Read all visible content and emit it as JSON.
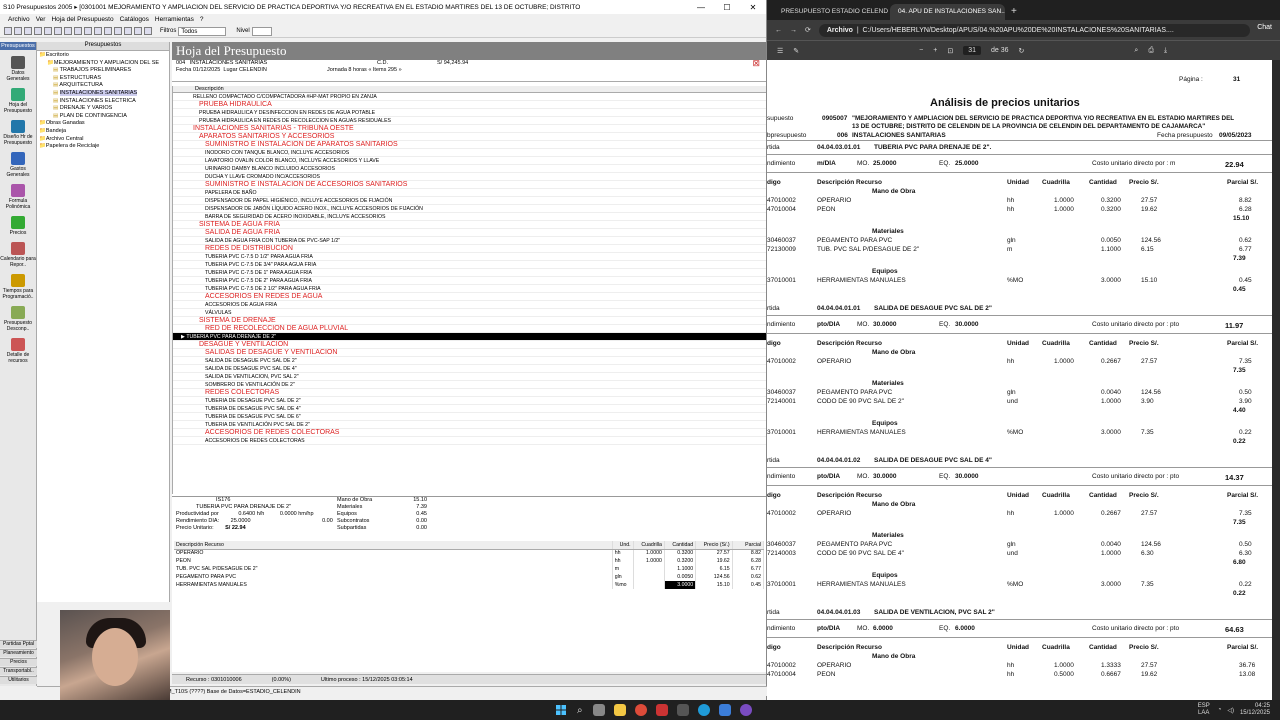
{
  "s10": {
    "title": "S10 Presupuestos 2005 ▸ [0301001 MEJORAMIENTO Y AMPLIACION DEL SERVICIO DE PRACTICA DEPORTIVA Y/O RECREATIVA EN EL ESTADIO MARTIRES DEL 13 DE OCTUBRE; DISTRITO",
    "menu": [
      "Archivo",
      "Ver",
      "Hoja del Presupuesto",
      "Catálogos",
      "Herramientas",
      "?"
    ],
    "filtros_label": "Filtros",
    "filtros_value": "Todos",
    "nivel_label": "Nivel",
    "nivel_value": "",
    "nav_header": "Presupuestos",
    "nav": [
      "Datos Generales",
      "Hoja del Presupuesto",
      "Diseño Hr de Presupuesto",
      "Gastos Generales",
      "Formula Polinómica",
      "Precios",
      "Calendario para Repor..",
      "Tiempos para Programació..",
      "Presupuesto Desconp..",
      "Detalle de recursos"
    ],
    "nav_bottom": [
      "Partidas Pptal",
      "Planeamiento",
      "Precios",
      "Transportabl..",
      "Utilitarios"
    ],
    "tree_header": "Presupuestos",
    "tree": [
      "Escritorio",
      "MEJORAMIENTO Y AMPLIACION DEL SE",
      "TRABAJOS PRELIMINARES",
      "ESTRUCTURAS",
      "ARQUITECTURA",
      "INSTALACIONES SANITARIAS",
      "INSTALACIONES ELECTRICA",
      "DRENAJE Y VARIOS",
      "PLAN DE CONTINGENCIA",
      "Obras Ganadas",
      "Bandeja",
      "Archivo Central",
      "Papelera de Reciclaje"
    ],
    "hoja_title": "Hoja del Presupuesto",
    "info": {
      "code": "004",
      "name": "INSTALACIONES SANITARIAS",
      "cd_label": "C.D.",
      "cd_value": "S/ 94,245.94",
      "fecha_label": "Fecha",
      "fecha": "01/12/2025",
      "lugar_label": "Lugar",
      "lugar": "CELENDIN",
      "jornada_label": "Jornada",
      "jornada": "8",
      "horas": "horas",
      "items": "« Items 295 »"
    },
    "col_descripcion": "Descripción",
    "rows": [
      {
        "t": 0,
        "i": 0,
        "text": "RELLENO COMPACTADO C/COMPACTADORA #HP-MAT PROPIO EN ZANJA"
      },
      {
        "t": 1,
        "i": 1,
        "text": "PRUEBA HIDRAULICA"
      },
      {
        "t": 0,
        "i": 1,
        "text": "PRUEBA HIDRAULICA Y DESINFECCION EN REDES DE AGUA POTABLE"
      },
      {
        "t": 0,
        "i": 1,
        "text": "PRUEBA HIDRAULICA EN REDES DE RECOLECCION EN AGUAS RESIDUALES"
      },
      {
        "t": 1,
        "i": 0,
        "text": "INSTALACIONES SANITARIAS - TRIBUNA OESTE"
      },
      {
        "t": 1,
        "i": 1,
        "text": "APARATOS SANITARIOS Y ACCESORIOS"
      },
      {
        "t": 1,
        "i": 2,
        "text": "SUMINISTRO E INSTALACION DE APARATOS SANITARIOS"
      },
      {
        "t": 0,
        "i": 2,
        "text": "INODORO CON TANQUE BLANCO, INCLUYE ACCESORIOS"
      },
      {
        "t": 0,
        "i": 2,
        "text": "LAVATORIO OVALIN COLOR BLANCO, INCLUYE ACCESORIOS Y LLAVE"
      },
      {
        "t": 0,
        "i": 2,
        "text": "URINARIO DAMBY BLANCO INCLUIDO ACCESORIOS"
      },
      {
        "t": 0,
        "i": 2,
        "text": "DUCHA Y LLAVE CROMADO INC/ACCESORIOS"
      },
      {
        "t": 1,
        "i": 2,
        "text": "SUMINISTRO E INSTALACION DE ACCESORIOS SANITARIOS"
      },
      {
        "t": 0,
        "i": 2,
        "text": "PAPELERA DE BAÑO"
      },
      {
        "t": 0,
        "i": 2,
        "text": "DISPENSADOR DE PAPEL HIGIÉNICO, INCLUYE ACCESORIOS DE FIJACIÓN"
      },
      {
        "t": 0,
        "i": 2,
        "text": "DISPENSADOR DE JABÓN LÍQUIDO ACERO INOX., INCLUYE ACCESORIOS DE FIJACIÓN"
      },
      {
        "t": 0,
        "i": 2,
        "text": "BARRA DE SEGURIDAD DE ACERO INOXIDABLE, INCLUYE ACCESORIOS"
      },
      {
        "t": 1,
        "i": 1,
        "text": "SISTEMA DE AGUA FRIA"
      },
      {
        "t": 1,
        "i": 2,
        "text": "SALIDA DE AGUA FRIA"
      },
      {
        "t": 0,
        "i": 2,
        "text": "SALIDA DE AGUA FRIA CON TUBERIA DE PVC-SAP 1/2\""
      },
      {
        "t": 1,
        "i": 2,
        "text": "REDES DE DISTRIBUCION"
      },
      {
        "t": 0,
        "i": 2,
        "text": "TUBERIA PVC C-7.5 D 1/2\" PARA AGUA FRIA"
      },
      {
        "t": 0,
        "i": 2,
        "text": "TUBERIA PVC C-7.5 DE 3/4\" PARA AGUA FRIA"
      },
      {
        "t": 0,
        "i": 2,
        "text": "TUBERIA PVC C-7.5 DE 1\" PARA AGUA FRIA"
      },
      {
        "t": 0,
        "i": 2,
        "text": "TUBERIA PVC C-7.5 DE 2\" PARA AGUA FRIA"
      },
      {
        "t": 0,
        "i": 2,
        "text": "TUBERIA PVC C-7.5 DE 2 1/2\" PARA AGUA FRIA"
      },
      {
        "t": 1,
        "i": 2,
        "text": "ACCESORIOS EN REDES DE AGUA"
      },
      {
        "t": 0,
        "i": 2,
        "text": "ACCESORIOS DE AGUA FRIA"
      },
      {
        "t": 0,
        "i": 2,
        "text": "VÁLVULAS"
      },
      {
        "t": 1,
        "i": 1,
        "text": "SISTEMA DE DRENAJE"
      },
      {
        "t": 1,
        "i": 2,
        "text": "RED DE RECOLECCIÓN DE AGUA PLUVIAL"
      },
      {
        "t": 0,
        "i": 2,
        "text": "TUBERIA PVC PARA DRENAJE DE 2\"",
        "sel": true
      },
      {
        "t": 1,
        "i": 1,
        "text": "DESAGUE Y VENTILACION"
      },
      {
        "t": 1,
        "i": 2,
        "text": "SALIDAS DE DESAGUE Y VENTILACION"
      },
      {
        "t": 0,
        "i": 2,
        "text": "SALIDA DE DESAGUE PVC SAL DE 2\""
      },
      {
        "t": 0,
        "i": 2,
        "text": "SALIDA DE DESAGUE PVC SAL DE 4\""
      },
      {
        "t": 0,
        "i": 2,
        "text": "SALIDA DE VENTILACION, PVC SAL 2\""
      },
      {
        "t": 0,
        "i": 2,
        "text": "SOMBRERO DE VENTILACIÓN DE 2\""
      },
      {
        "t": 1,
        "i": 2,
        "text": "REDES COLECTORAS"
      },
      {
        "t": 0,
        "i": 2,
        "text": "TUBERIA DE DESAGUE PVC SAL DE 2\""
      },
      {
        "t": 0,
        "i": 2,
        "text": "TUBERIA DE DESAGUE PVC SAL DE 4\""
      },
      {
        "t": 0,
        "i": 2,
        "text": "TUBERIA DE DESAGUE PVC SAL DE 6\""
      },
      {
        "t": 0,
        "i": 2,
        "text": "TUBERIA DE VENTILACIÓN PVC SAL DE 2\""
      },
      {
        "t": 1,
        "i": 2,
        "text": "ACCESORIOS DE REDES COLECTORAS"
      },
      {
        "t": 0,
        "i": 2,
        "text": "ACCESORIOS DE REDES COLECTORAS"
      }
    ],
    "detail": {
      "code": "IS176",
      "partida": "TUBERIA PVC PARA DRENAJE DE 2\"",
      "prod_label": "Productividad por",
      "prod1": "0.6400 h/h",
      "prod2": "0.0000 hm/hp",
      "rend_label": "Rendimiento DIA:",
      "rend": "25.0000",
      "rend2": "0.00",
      "pu_label": "Precio Unitario:",
      "pu": "S/ 22.94",
      "summary": [
        {
          "k": "Mano de Obra",
          "v": "15.10"
        },
        {
          "k": "Materiales",
          "v": "7.39"
        },
        {
          "k": "Equipos",
          "v": "0.45"
        },
        {
          "k": "Subcontratos",
          "v": "0.00"
        },
        {
          "k": "Subpartidas",
          "v": "0.00"
        }
      ],
      "headers": [
        "Descripción Recurso",
        "Und.",
        "Cuadrilla",
        "Cantidad",
        "Precio (S/.)",
        "Parcial"
      ],
      "rows": [
        [
          "OPERARIO",
          "hh",
          "1.0000",
          "0.3200",
          "27.57",
          "8.82"
        ],
        [
          "PEON",
          "hh",
          "1.0000",
          "0.3200",
          "19.62",
          "6.28"
        ],
        [
          "TUB. PVC SAL P/DESAGUE DE 2\"",
          "m",
          "",
          "1.1000",
          "6.15",
          "6.77"
        ],
        [
          "PEGAMENTO PARA PVC",
          "gln",
          "",
          "0.0050",
          "124.56",
          "0.62"
        ],
        [
          "HERRAMIENTAS MANUALES",
          "%mo",
          "",
          "3.0000",
          "15.10",
          "0.45"
        ]
      ]
    },
    "status": [
      "Recurso : 0301010006",
      "(0.00%)",
      "Ultimo proceso : 15/12/2025 03:05:14"
    ],
    "statusbot": "M_T10S (????) Base de Datos=ESTADIO_CELENDIN"
  },
  "browser": {
    "tabs": [
      "PRESUPUESTO ESTADIO CELENDIN...",
      "04. APU DE INSTALACIONES SAN..."
    ],
    "addr_label": "Archivo",
    "url": "C:/Users/HEBERLYN/Desktop/APUS/04.%20APU%20DE%20INSTALACIONES%20SANITARIAS....",
    "chat": "Chat",
    "page": "31",
    "page_of": "de 36"
  },
  "pdf": {
    "pagina_label": "Página :",
    "pagina": "31",
    "heading": "Análisis de precios unitarios",
    "presupuesto_code": "0905007",
    "presupuesto_text1": "\"MEJORAMIENTO Y AMPLIACION DEL SERVICIO DE PRACTICA DEPORTIVA Y/O RECREATIVA EN EL ESTADIO MARTIRES DEL",
    "presupuesto_text2": "13 DE OCTUBRE; DISTRITO DE CELENDIN DE LA PROVINCIA DE CELENDIN DEL DEPARTAMENTO DE CAJAMARCA\"",
    "presupuesto_label": "supuesto",
    "subpresupuesto_label": "bpresupuesto",
    "sub_code": "006",
    "sub_name": "INSTALACIONES SANITARIAS",
    "fecha_label": "Fecha presupuesto",
    "fecha": "09/05/2023",
    "col_headers": [
      "digo",
      "Descripción Recurso",
      "Unidad",
      "Cuadrilla",
      "Cantidad",
      "Precio S/.",
      "Parcial S/."
    ],
    "blocks": [
      {
        "code": "04.04.03.01.01",
        "name": "TUBERIA PVC PARA DRENAJE DE 2\".",
        "rend": "m/DIA",
        "mo": "25.0000",
        "eq": "25.0000",
        "costo_label": "Costo unitario directo por : m",
        "costo": "22.94",
        "groups": [
          {
            "g": "Mano de Obra",
            "items": [
              [
                "47010002",
                "OPERARIO",
                "hh",
                "1.0000",
                "0.3200",
                "27.57",
                "8.82"
              ],
              [
                "47010004",
                "PEON",
                "hh",
                "1.0000",
                "0.3200",
                "19.62",
                "6.28"
              ]
            ],
            "sub": "15.10"
          },
          {
            "g": "Materiales",
            "items": [
              [
                "30460037",
                "PEGAMENTO PARA PVC",
                "gln",
                "",
                "0.0050",
                "124.56",
                "0.62"
              ],
              [
                "72130009",
                "TUB. PVC SAL P/DESAGUE DE 2\"",
                "m",
                "",
                "1.1000",
                "6.15",
                "6.77"
              ]
            ],
            "sub": "7.39"
          },
          {
            "g": "Equipos",
            "items": [
              [
                "37010001",
                "HERRAMIENTAS MANUALES",
                "%MO",
                "",
                "3.0000",
                "15.10",
                "0.45"
              ]
            ],
            "sub": "0.45"
          }
        ]
      },
      {
        "code": "04.04.04.01.01",
        "name": "SALIDA DE DESAGUE PVC SAL DE 2\"",
        "rend": "pto/DIA",
        "mo": "30.0000",
        "eq": "30.0000",
        "costo_label": "Costo unitario directo por : pto",
        "costo": "11.97",
        "groups": [
          {
            "g": "Mano de Obra",
            "items": [
              [
                "47010002",
                "OPERARIO",
                "hh",
                "1.0000",
                "0.2667",
                "27.57",
                "7.35"
              ]
            ],
            "sub": "7.35"
          },
          {
            "g": "Materiales",
            "items": [
              [
                "30460037",
                "PEGAMENTO PARA PVC",
                "gln",
                "",
                "0.0040",
                "124.56",
                "0.50"
              ],
              [
                "72140001",
                "CODO DE 90 PVC SAL DE 2\"",
                "und",
                "",
                "1.0000",
                "3.90",
                "3.90"
              ]
            ],
            "sub": "4.40"
          },
          {
            "g": "Equipos",
            "items": [
              [
                "37010001",
                "HERRAMIENTAS MANUALES",
                "%MO",
                "",
                "3.0000",
                "7.35",
                "0.22"
              ]
            ],
            "sub": "0.22"
          }
        ]
      },
      {
        "code": "04.04.04.01.02",
        "name": "SALIDA DE DESAGUE PVC SAL DE 4\"",
        "rend": "pto/DIA",
        "mo": "30.0000",
        "eq": "30.0000",
        "costo_label": "Costo unitario directo por : pto",
        "costo": "14.37",
        "groups": [
          {
            "g": "Mano de Obra",
            "items": [
              [
                "47010002",
                "OPERARIO",
                "hh",
                "1.0000",
                "0.2667",
                "27.57",
                "7.35"
              ]
            ],
            "sub": "7.35"
          },
          {
            "g": "Materiales",
            "items": [
              [
                "30460037",
                "PEGAMENTO PARA PVC",
                "gln",
                "",
                "0.0040",
                "124.56",
                "0.50"
              ],
              [
                "72140003",
                "CODO DE 90 PVC SAL DE 4\"",
                "und",
                "",
                "1.0000",
                "6.30",
                "6.30"
              ]
            ],
            "sub": "6.80"
          },
          {
            "g": "Equipos",
            "items": [
              [
                "37010001",
                "HERRAMIENTAS MANUALES",
                "%MO",
                "",
                "3.0000",
                "7.35",
                "0.22"
              ]
            ],
            "sub": "0.22"
          }
        ]
      },
      {
        "code": "04.04.04.01.03",
        "name": "SALIDA DE VENTILACION, PVC SAL 2\"",
        "rend": "pto/DIA",
        "mo": "6.0000",
        "eq": "6.0000",
        "costo_label": "Costo unitario directo por : pto",
        "costo": "64.63",
        "groups": [
          {
            "g": "Mano de Obra",
            "items": [
              [
                "47010002",
                "OPERARIO",
                "hh",
                "1.0000",
                "1.3333",
                "27.57",
                "36.76"
              ],
              [
                "47010004",
                "PEON",
                "hh",
                "0.5000",
                "0.6667",
                "19.62",
                "13.08"
              ]
            ],
            "sub": ""
          }
        ]
      }
    ],
    "labels": {
      "partida": "rtida",
      "rendimiento": "ndimiento",
      "mo": "MO.",
      "eq": "EQ."
    }
  },
  "taskbar": {
    "lang1": "ESP",
    "lang2": "LAA",
    "time": "04:25",
    "date": "15/12/2025"
  }
}
